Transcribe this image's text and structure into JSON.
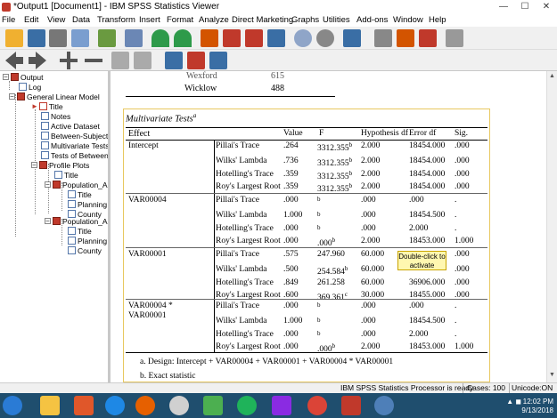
{
  "window": {
    "title": "*Output1 [Document1] - IBM SPSS Statistics Viewer",
    "min": "—",
    "max": "☐",
    "close": "✕"
  },
  "menu": [
    "File",
    "Edit",
    "View",
    "Data",
    "Transform",
    "Insert",
    "Format",
    "Analyze",
    "Direct Marketing",
    "Graphs",
    "Utilities",
    "Add-ons",
    "Window",
    "Help"
  ],
  "outline": {
    "items": [
      {
        "label": "Output",
        "icon": "book-icon"
      },
      {
        "label": "Log",
        "icon": "page-icon"
      },
      {
        "label": "General Linear Model",
        "icon": "book-icon"
      },
      {
        "label": "Title",
        "icon": "page-icon"
      },
      {
        "label": "Notes",
        "icon": "page-icon"
      },
      {
        "label": "Active Dataset",
        "icon": "page-icon"
      },
      {
        "label": "Between-Subjects",
        "icon": "page-icon"
      },
      {
        "label": "Multivariate Tests",
        "icon": "page-icon"
      },
      {
        "label": "Tests of Between-",
        "icon": "page-icon"
      },
      {
        "label": "Profile Plots",
        "icon": "book-icon"
      },
      {
        "label": "Title",
        "icon": "page-icon"
      },
      {
        "label": "Population_A",
        "icon": "book-icon"
      },
      {
        "label": "Title",
        "icon": "page-icon"
      },
      {
        "label": "Planning",
        "icon": "page-icon"
      },
      {
        "label": "County",
        "icon": "page-icon"
      },
      {
        "label": "Population_A",
        "icon": "book-icon"
      },
      {
        "label": "Title",
        "icon": "page-icon"
      },
      {
        "label": "Planning",
        "icon": "page-icon"
      },
      {
        "label": "County",
        "icon": "page-icon"
      }
    ]
  },
  "freq_rows": [
    {
      "name": "Wexford",
      "value": "615"
    },
    {
      "name": "Wicklow",
      "value": "488"
    }
  ],
  "mv_table": {
    "title": "Multivariate Tests",
    "title_sup": "a",
    "headers": [
      "Effect",
      "Value",
      "F",
      "Hypothesis df",
      "Error df",
      "Sig."
    ],
    "groups": [
      {
        "effect": "Intercept",
        "effect2": "",
        "rows": [
          {
            "test": "Pillai's Trace",
            "value": ".264",
            "f": "3312.355",
            "fsup": "b",
            "hdf": "2.000",
            "edf": "18454.000",
            "sig": ".000"
          },
          {
            "test": "Wilks' Lambda",
            "value": ".736",
            "f": "3312.355",
            "fsup": "b",
            "hdf": "2.000",
            "edf": "18454.000",
            "sig": ".000"
          },
          {
            "test": "Hotelling's Trace",
            "value": ".359",
            "f": "3312.355",
            "fsup": "b",
            "hdf": "2.000",
            "edf": "18454.000",
            "sig": ".000"
          },
          {
            "test": "Roy's Largest Root",
            "value": ".359",
            "f": "3312.355",
            "fsup": "b",
            "hdf": "2.000",
            "edf": "18454.000",
            "sig": ".000"
          }
        ]
      },
      {
        "effect": "VAR00004",
        "effect2": "",
        "rows": [
          {
            "test": "Pillai's Trace",
            "value": ".000",
            "f": "",
            "fsup": "b",
            "hdf": ".000",
            "edf": ".000",
            "sig": "."
          },
          {
            "test": "Wilks' Lambda",
            "value": "1.000",
            "f": "",
            "fsup": "b",
            "hdf": ".000",
            "edf": "18454.500",
            "sig": "."
          },
          {
            "test": "Hotelling's Trace",
            "value": ".000",
            "f": "",
            "fsup": "b",
            "hdf": ".000",
            "edf": "2.000",
            "sig": "."
          },
          {
            "test": "Roy's Largest Root",
            "value": ".000",
            "f": ".000",
            "fsup": "b",
            "hdf": "2.000",
            "edf": "18453.000",
            "sig": "1.000"
          }
        ]
      },
      {
        "effect": "VAR00001",
        "effect2": "",
        "rows": [
          {
            "test": "Pillai's Trace",
            "value": ".575",
            "f": "247.960",
            "fsup": "",
            "hdf": "60.000",
            "edf": "",
            "sig": ".000"
          },
          {
            "test": "Wilks' Lambda",
            "value": ".500",
            "f": "254.584",
            "fsup": "b",
            "hdf": "60.000",
            "edf": "",
            "sig": ".000"
          },
          {
            "test": "Hotelling's Trace",
            "value": ".849",
            "f": "261.258",
            "fsup": "",
            "hdf": "60.000",
            "edf": "36906.000",
            "sig": ".000"
          },
          {
            "test": "Roy's Largest Root",
            "value": ".600",
            "f": "369.361",
            "fsup": "c",
            "hdf": "30.000",
            "edf": "18455.000",
            "sig": ".000"
          }
        ]
      },
      {
        "effect": "VAR00004 *",
        "effect2": "VAR00001",
        "rows": [
          {
            "test": "Pillai's Trace",
            "value": ".000",
            "f": "",
            "fsup": "b",
            "hdf": ".000",
            "edf": ".000",
            "sig": "."
          },
          {
            "test": "Wilks' Lambda",
            "value": "1.000",
            "f": "",
            "fsup": "b",
            "hdf": ".000",
            "edf": "18454.500",
            "sig": "."
          },
          {
            "test": "Hotelling's Trace",
            "value": ".000",
            "f": "",
            "fsup": "b",
            "hdf": ".000",
            "edf": "2.000",
            "sig": "."
          },
          {
            "test": "Roy's Largest Root",
            "value": ".000",
            "f": ".000",
            "fsup": "b",
            "hdf": "2.000",
            "edf": "18453.000",
            "sig": "1.000"
          }
        ]
      }
    ],
    "footnotes": [
      "a. Design: Intercept + VAR00004 + VAR00001 + VAR00004 * VAR00001",
      "b. Exact statistic"
    ]
  },
  "tooltip": {
    "line1": "Double-click to",
    "line2": "activate"
  },
  "status": {
    "processor": "IBM SPSS Statistics Processor is ready",
    "cases": "Cases: 100",
    "unicode": "Unicode:ON"
  },
  "clock": {
    "time": "12:02 PM",
    "date": "9/13/2018"
  },
  "colors": {
    "taskbar": "#1f4e6e",
    "accent": "#c0392b",
    "tooltip_bg": "#fff7b0"
  }
}
